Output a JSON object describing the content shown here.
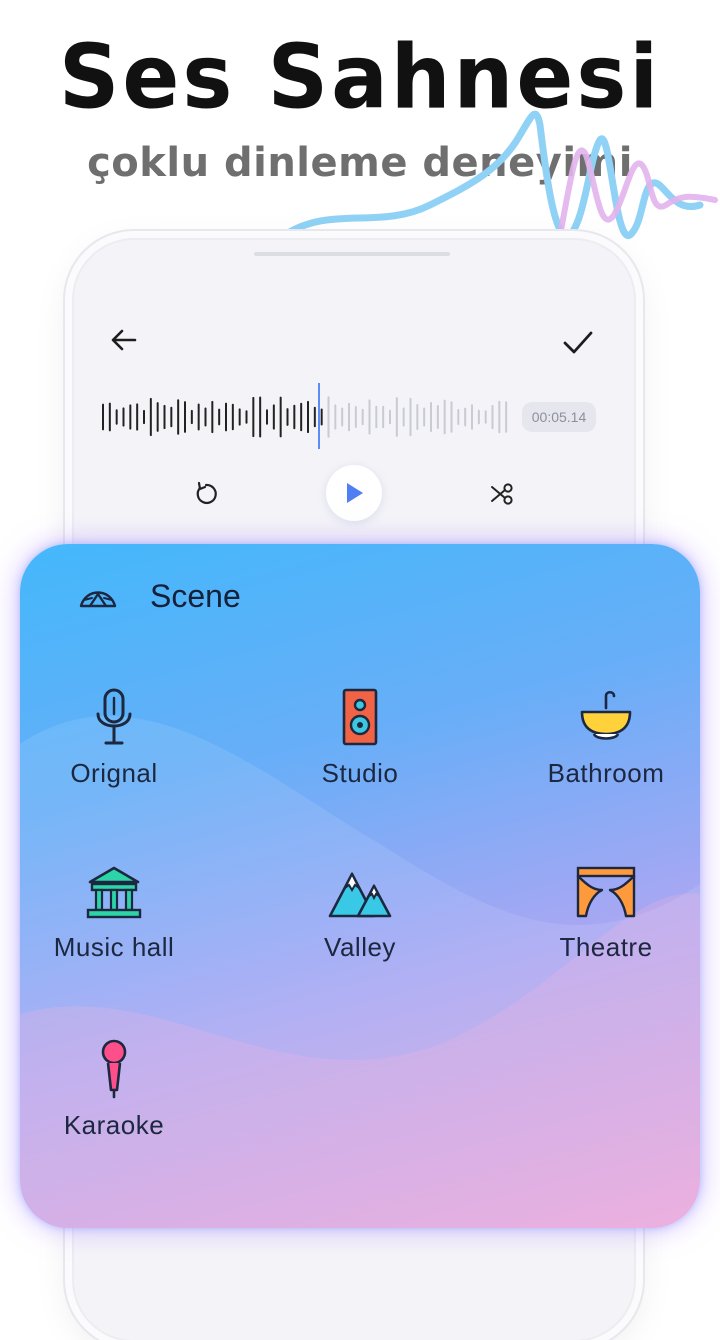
{
  "headline": "Ses Sahnesi",
  "subheadline": "çoklu dinleme deneyimi",
  "editor": {
    "back_icon": "arrow-left-icon",
    "confirm_icon": "check-icon",
    "time": "00:05.14",
    "play_progress": 0.54,
    "controls": [
      "replay-icon",
      "play-icon",
      "scissors-icon"
    ]
  },
  "scene_panel": {
    "title": "Scene",
    "icon": "tent-icon",
    "items": [
      {
        "label": "Orignal",
        "icon": "microphone-icon"
      },
      {
        "label": "Studio",
        "icon": "speaker-icon"
      },
      {
        "label": "Bathroom",
        "icon": "sink-icon"
      },
      {
        "label": "Music hall",
        "icon": "hall-icon"
      },
      {
        "label": "Valley",
        "icon": "mountains-icon"
      },
      {
        "label": "Theatre",
        "icon": "curtain-icon"
      },
      {
        "label": "Karaoke",
        "icon": "karaoke-mic-icon"
      }
    ]
  },
  "colors": {
    "accent": "#4f7ff2",
    "panel_top": "#44b8fb",
    "panel_bottom": "#e5a6dc",
    "headline": "#111111",
    "subheadline": "#6f6f6f"
  }
}
